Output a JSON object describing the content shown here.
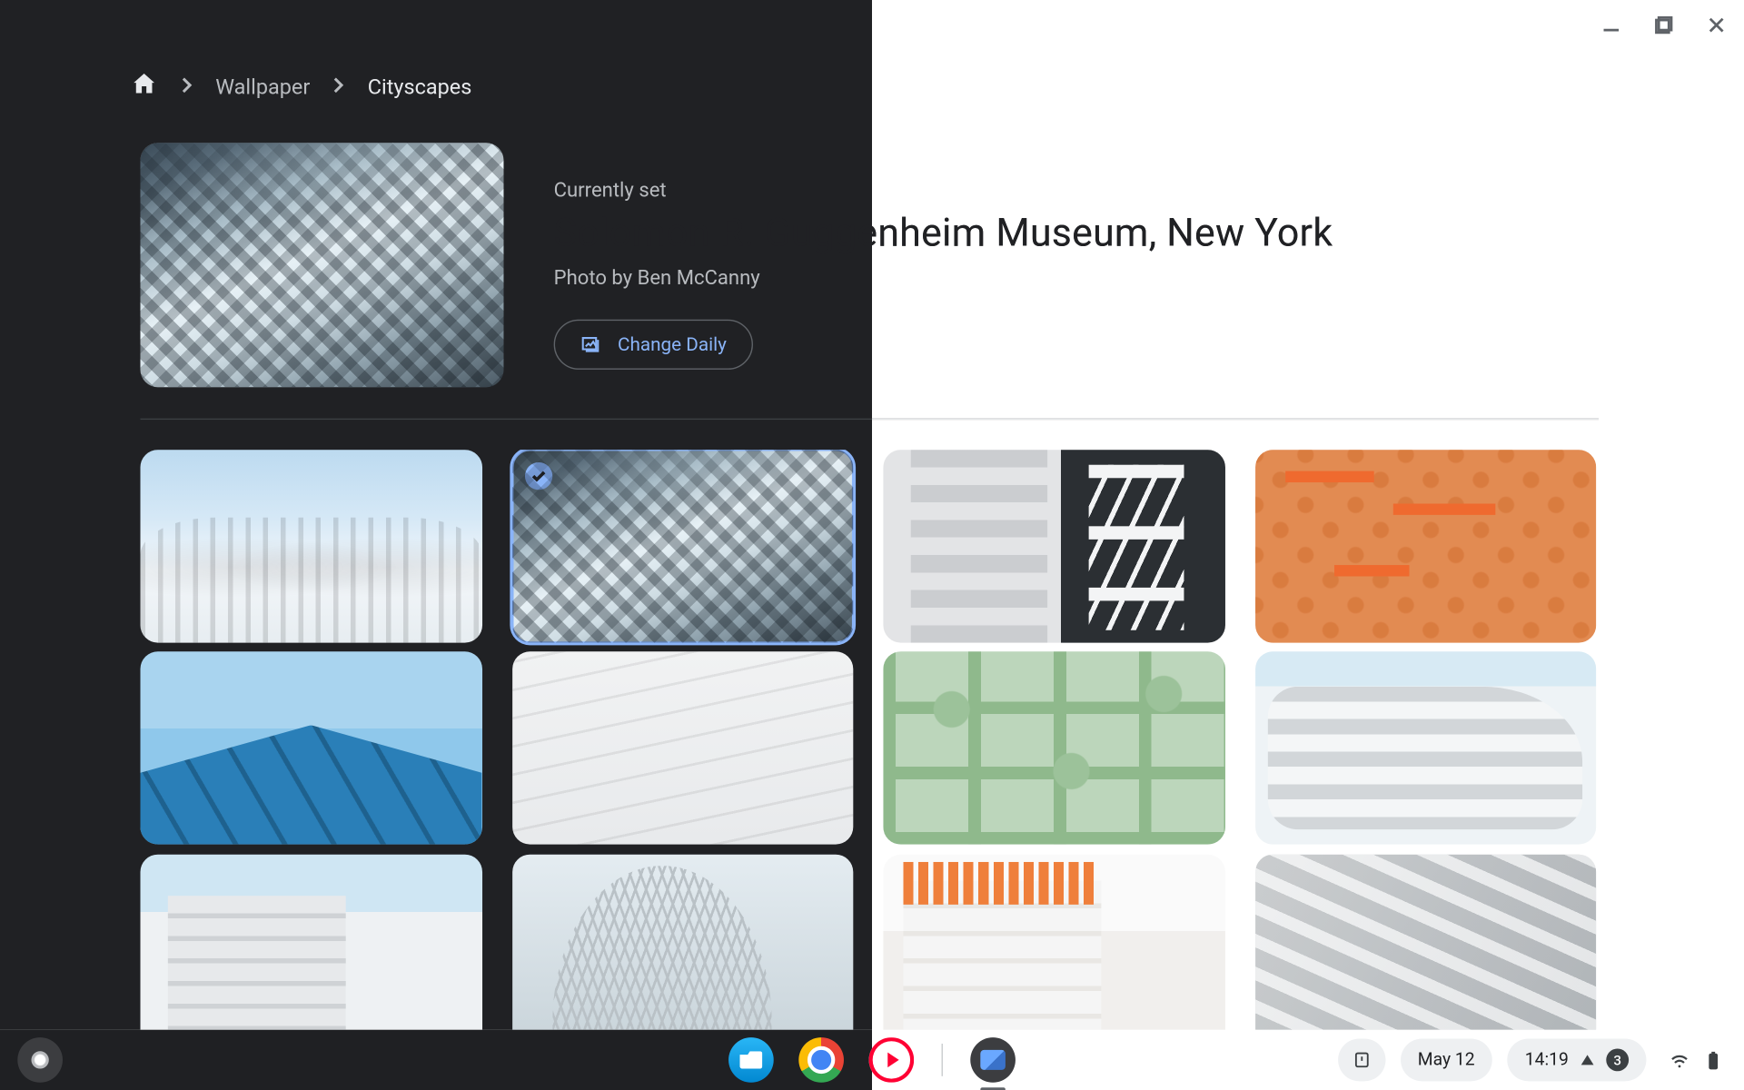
{
  "breadcrumb": {
    "home_icon": "home-icon",
    "items": [
      "Wallpaper",
      "Cityscapes"
    ],
    "active_index": 1
  },
  "current": {
    "label": "Currently set",
    "title": "Solomon R. Guggenheim Museum, New York",
    "credit": "Photo by Ben McCanny",
    "change_daily": "Change Daily"
  },
  "grid": {
    "selected_index": 1,
    "tiles": [
      {
        "name": "cityscape-thumb-1"
      },
      {
        "name": "cityscape-thumb-2"
      },
      {
        "name": "cityscape-thumb-3"
      },
      {
        "name": "cityscape-thumb-4"
      },
      {
        "name": "cityscape-thumb-5"
      },
      {
        "name": "cityscape-thumb-6"
      },
      {
        "name": "cityscape-thumb-7"
      },
      {
        "name": "cityscape-thumb-8"
      },
      {
        "name": "cityscape-thumb-9"
      },
      {
        "name": "cityscape-thumb-10"
      },
      {
        "name": "cityscape-thumb-11"
      },
      {
        "name": "cityscape-thumb-12"
      }
    ]
  },
  "shelf": {
    "date": "May 12",
    "time": "14:19",
    "notification_count": "3"
  }
}
